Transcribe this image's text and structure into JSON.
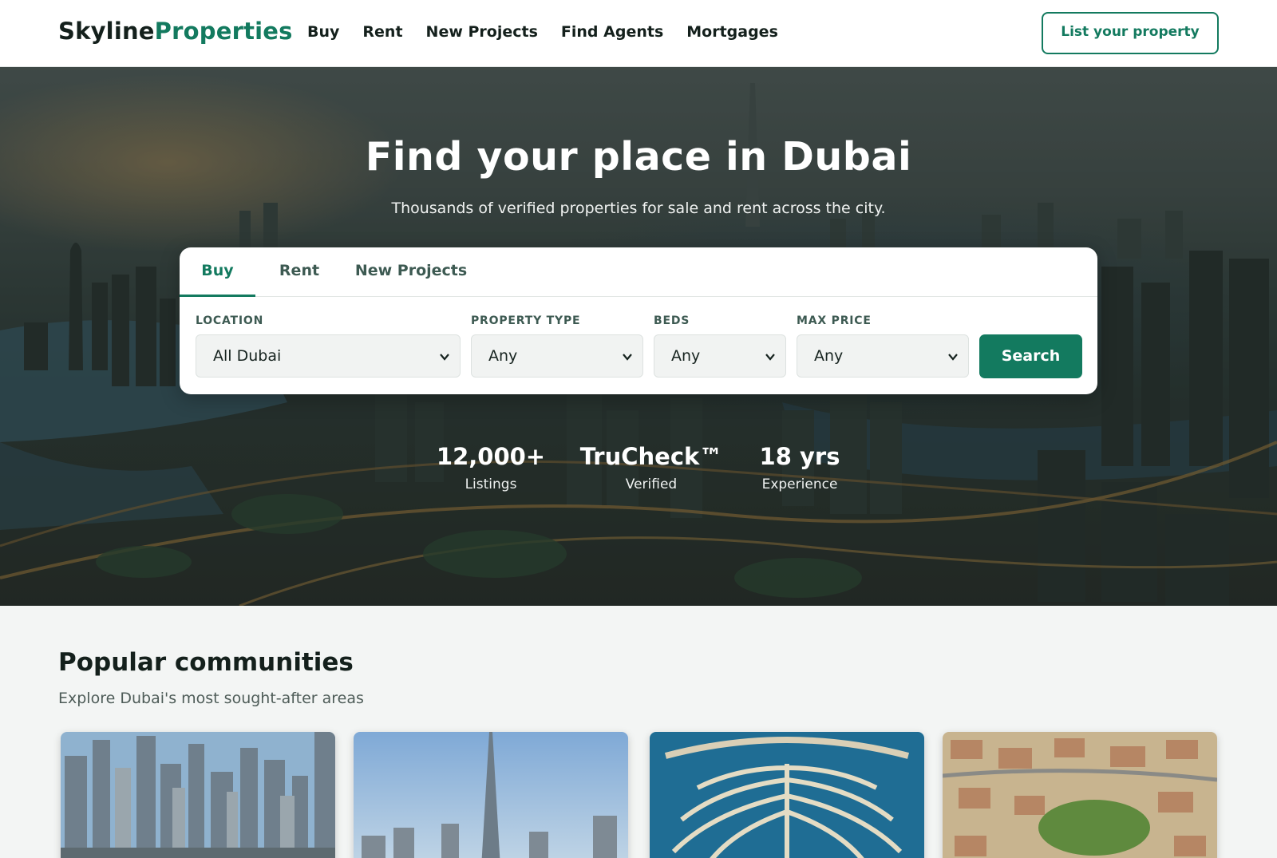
{
  "header": {
    "logo_part1": "Skyline",
    "logo_part2": "Properties",
    "nav": [
      {
        "label": "Buy"
      },
      {
        "label": "Rent"
      },
      {
        "label": "New Projects"
      },
      {
        "label": "Find Agents"
      },
      {
        "label": "Mortgages"
      }
    ],
    "cta_label": "List your property"
  },
  "hero": {
    "title": "Find your place in Dubai",
    "subtitle": "Thousands of verified properties for sale and rent across the city."
  },
  "search": {
    "tabs": [
      {
        "label": "Buy",
        "active": true
      },
      {
        "label": "Rent",
        "active": false
      },
      {
        "label": "New Projects",
        "active": false
      }
    ],
    "fields": [
      {
        "label": "LOCATION",
        "value": "All Dubai"
      },
      {
        "label": "PROPERTY TYPE",
        "value": "Any"
      },
      {
        "label": "BEDS",
        "value": "Any"
      },
      {
        "label": "MAX PRICE",
        "value": "Any"
      }
    ],
    "button_label": "Search"
  },
  "stats": [
    {
      "value": "12,000+",
      "label": "Listings"
    },
    {
      "value": "TruCheck™",
      "label": "Verified"
    },
    {
      "value": "18 yrs",
      "label": "Experience"
    }
  ],
  "communities": {
    "title": "Popular communities",
    "subtitle": "Explore Dubai's most sought-after areas",
    "cards": [
      {
        "image": "marina-skyline"
      },
      {
        "image": "downtown-burj-khalifa"
      },
      {
        "image": "palm-jumeirah-aerial"
      },
      {
        "image": "villa-community-aerial"
      }
    ]
  },
  "colors": {
    "brand": "#137a5f",
    "text": "#14201c",
    "page_bg": "#f3f5f4"
  }
}
